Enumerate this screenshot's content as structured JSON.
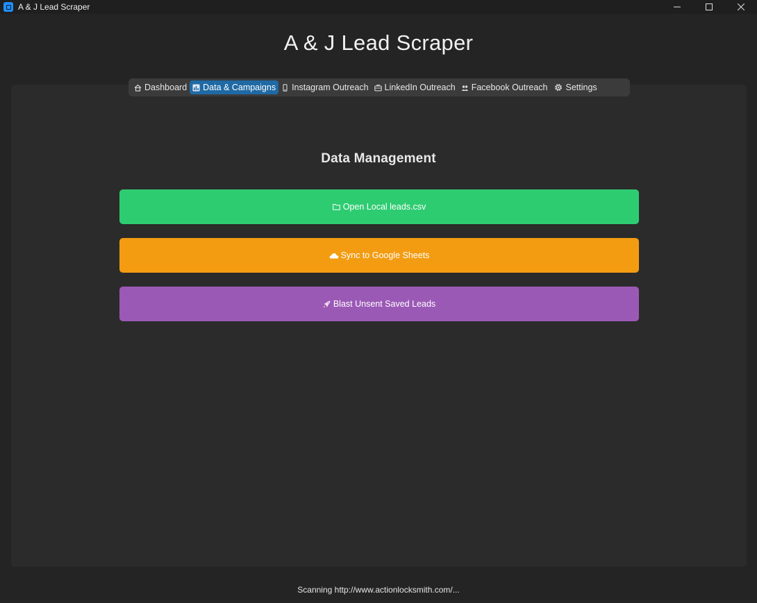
{
  "window": {
    "title": "A & J Lead Scraper"
  },
  "header": {
    "title": "A & J Lead Scraper"
  },
  "tabs": [
    {
      "label": "Dashboard",
      "icon": "house-icon",
      "active": false
    },
    {
      "label": "Data & Campaigns",
      "icon": "bar-chart-icon",
      "active": true
    },
    {
      "label": "Instagram Outreach",
      "icon": "phone-icon",
      "active": false
    },
    {
      "label": "LinkedIn Outreach",
      "icon": "briefcase-icon",
      "active": false
    },
    {
      "label": "Facebook Outreach",
      "icon": "people-icon",
      "active": false
    },
    {
      "label": "Settings",
      "icon": "gear-icon",
      "active": false
    }
  ],
  "main": {
    "section_title": "Data Management",
    "buttons": [
      {
        "label": "Open Local leads.csv",
        "icon": "folder-icon",
        "color": "#2ecc71"
      },
      {
        "label": "Sync to Google Sheets",
        "icon": "cloud-icon",
        "color": "#f39c12"
      },
      {
        "label": "Blast Unsent Saved Leads",
        "icon": "rocket-icon",
        "color": "#9b59b6"
      }
    ]
  },
  "status": {
    "text": "Scanning http://www.actionlocksmith.com/..."
  },
  "colors": {
    "accent": "#1f6aa5",
    "background": "#242424",
    "panel": "#2b2b2b"
  }
}
